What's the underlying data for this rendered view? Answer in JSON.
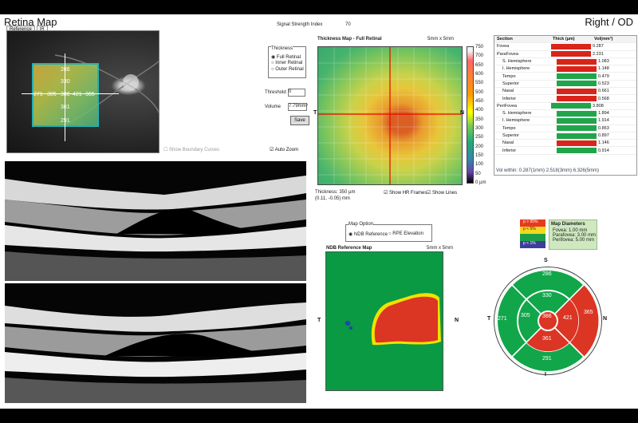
{
  "header": {
    "title": "Retina Map",
    "eye": "Right / OD",
    "signal_label": "Signal Strength Index",
    "signal_value": "70"
  },
  "fundus": {
    "tabs": [
      "Reference",
      "IR"
    ],
    "values": {
      "top": "286",
      "inner_top": "330",
      "left": "271",
      "inner_left": "305",
      "center": "386",
      "inner_right": "421",
      "right": "365",
      "inner_bottom": "361",
      "bottom": "291"
    },
    "show_boundary": "Show Boundary Curves",
    "auto_zoom": "Auto Zoom"
  },
  "controls": {
    "thickness_title": "Thickness",
    "options": [
      "Full Retinal",
      "Inner Retinal",
      "Outer Retinal"
    ],
    "threshold_label": "Threshold",
    "threshold_value": "0",
    "volume_label": "Volume",
    "volume_value": "7.79mm³",
    "save": "Save"
  },
  "thickness_map": {
    "title": "Thickness Map - Full Retinal",
    "size": "5mm x 5mm",
    "t": "T",
    "n": "N",
    "scale_ticks": [
      "750",
      "700",
      "650",
      "600",
      "550",
      "500",
      "450",
      "400",
      "350",
      "300",
      "250",
      "200",
      "150",
      "100",
      "50",
      "0 µm"
    ],
    "thickness_text": "Thickness: 350 µm",
    "coord_text": "(0.11, -0.05) mm",
    "show_hr": "Show HR Frames",
    "show_lines": "Show Lines"
  },
  "table": {
    "headers": [
      "Section",
      "Thick (µm)",
      "Vol(mm³)"
    ],
    "rows": [
      {
        "section": "Fovea",
        "indent": 0,
        "color": "#d9241a",
        "vol": "0.287"
      },
      {
        "section": "ParaFovea",
        "indent": 0,
        "color": "#d9241a",
        "vol": "2.231"
      },
      {
        "section": "S. Hemisphere",
        "indent": 1,
        "color": "#d9241a",
        "vol": "1.083"
      },
      {
        "section": "I. Hemisphere",
        "indent": 1,
        "color": "#d9241a",
        "vol": "1.148"
      },
      {
        "section": "Tempo",
        "indent": 1,
        "color": "#20a54a",
        "vol": "0.479"
      },
      {
        "section": "Superior",
        "indent": 1,
        "color": "#20a54a",
        "vol": "0.523"
      },
      {
        "section": "Nasal",
        "indent": 1,
        "color": "#d9241a",
        "vol": "0.661"
      },
      {
        "section": "Inferior",
        "indent": 1,
        "color": "#d9241a",
        "vol": "0.568"
      },
      {
        "section": "PeriFovea",
        "indent": 0,
        "color": "#20a54a",
        "vol": "3.808"
      },
      {
        "section": "S. Hemisphere",
        "indent": 1,
        "color": "#20a54a",
        "vol": "1.894"
      },
      {
        "section": "I. Hemisphere",
        "indent": 1,
        "color": "#20a54a",
        "vol": "1.914"
      },
      {
        "section": "Tempo",
        "indent": 1,
        "color": "#20a54a",
        "vol": "0.853"
      },
      {
        "section": "Superior",
        "indent": 1,
        "color": "#20a54a",
        "vol": "0.897"
      },
      {
        "section": "Nasal",
        "indent": 1,
        "color": "#d9241a",
        "vol": "1.146"
      },
      {
        "section": "Inferior",
        "indent": 1,
        "color": "#20a54a",
        "vol": "0.914"
      }
    ],
    "footer": "Vol within: 0.287(1mm) 2.518(3mm) 6.326(5mm)"
  },
  "ndb": {
    "map_option": "Map Option",
    "options": [
      "NDB Reference",
      "RPE Elevation"
    ],
    "title": "NDB Reference Map",
    "size": "5mm x 5mm",
    "t": "T",
    "n": "N"
  },
  "diameters": {
    "title": "Map Diameters",
    "rows": [
      "Fovea: 1.00 mm",
      "Parafovea: 3.00 mm",
      "Perifovea: 5.00 mm"
    ],
    "legend": [
      "p > 95%",
      "p < 5%",
      "p < 1%"
    ]
  },
  "sector_map": {
    "s": "S",
    "i": "I",
    "t": "T",
    "n": "N",
    "values": {
      "outer_top": "286",
      "inner_top": "330",
      "outer_left": "271",
      "inner_left": "305",
      "center": "386",
      "inner_right": "421",
      "outer_right": "365",
      "inner_bottom": "361",
      "outer_bottom": "291"
    }
  }
}
